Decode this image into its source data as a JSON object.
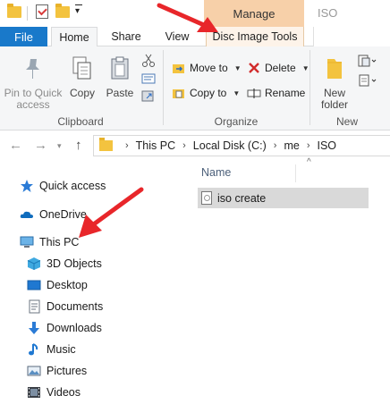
{
  "titlebar": {
    "context_tab_group": "Manage",
    "window_title": "ISO",
    "quick_access": [
      "folder-icon",
      "properties-icon",
      "new-folder-icon",
      "customize-quick-access"
    ]
  },
  "tabs": {
    "file": "File",
    "home": "Home",
    "share": "Share",
    "view": "View",
    "disc_image_tools": "Disc Image Tools"
  },
  "ribbon": {
    "clipboard": {
      "label": "Clipboard",
      "pin_to_quick_access": "Pin to Quick access",
      "copy": "Copy",
      "paste": "Paste",
      "mini_tools": [
        "cut-icon",
        "copy-path-icon",
        "paste-shortcut-icon"
      ]
    },
    "organize": {
      "label": "Organize",
      "move_to": "Move to",
      "copy_to": "Copy to",
      "delete": "Delete",
      "rename": "Rename"
    },
    "new": {
      "label": "New",
      "new_folder": "New folder",
      "mini_tools": [
        "new-item-icon",
        "easy-access-icon"
      ]
    }
  },
  "address": {
    "breadcrumbs": [
      "This PC",
      "Local Disk (C:)",
      "me",
      "ISO"
    ]
  },
  "nav": {
    "quick_access": "Quick access",
    "onedrive": "OneDrive",
    "this_pc": "This PC",
    "items": [
      "3D Objects",
      "Desktop",
      "Documents",
      "Downloads",
      "Music",
      "Pictures",
      "Videos"
    ]
  },
  "content": {
    "column_name": "Name",
    "files": [
      {
        "name": "iso create",
        "selected": true
      }
    ]
  },
  "colors": {
    "file_tab": "#1979ca",
    "manage_tab": "#f7d0a9",
    "ribbon_bg": "#f5f6f7",
    "selection": "#d9d9d9",
    "annotation_arrow": "#e8262a"
  }
}
